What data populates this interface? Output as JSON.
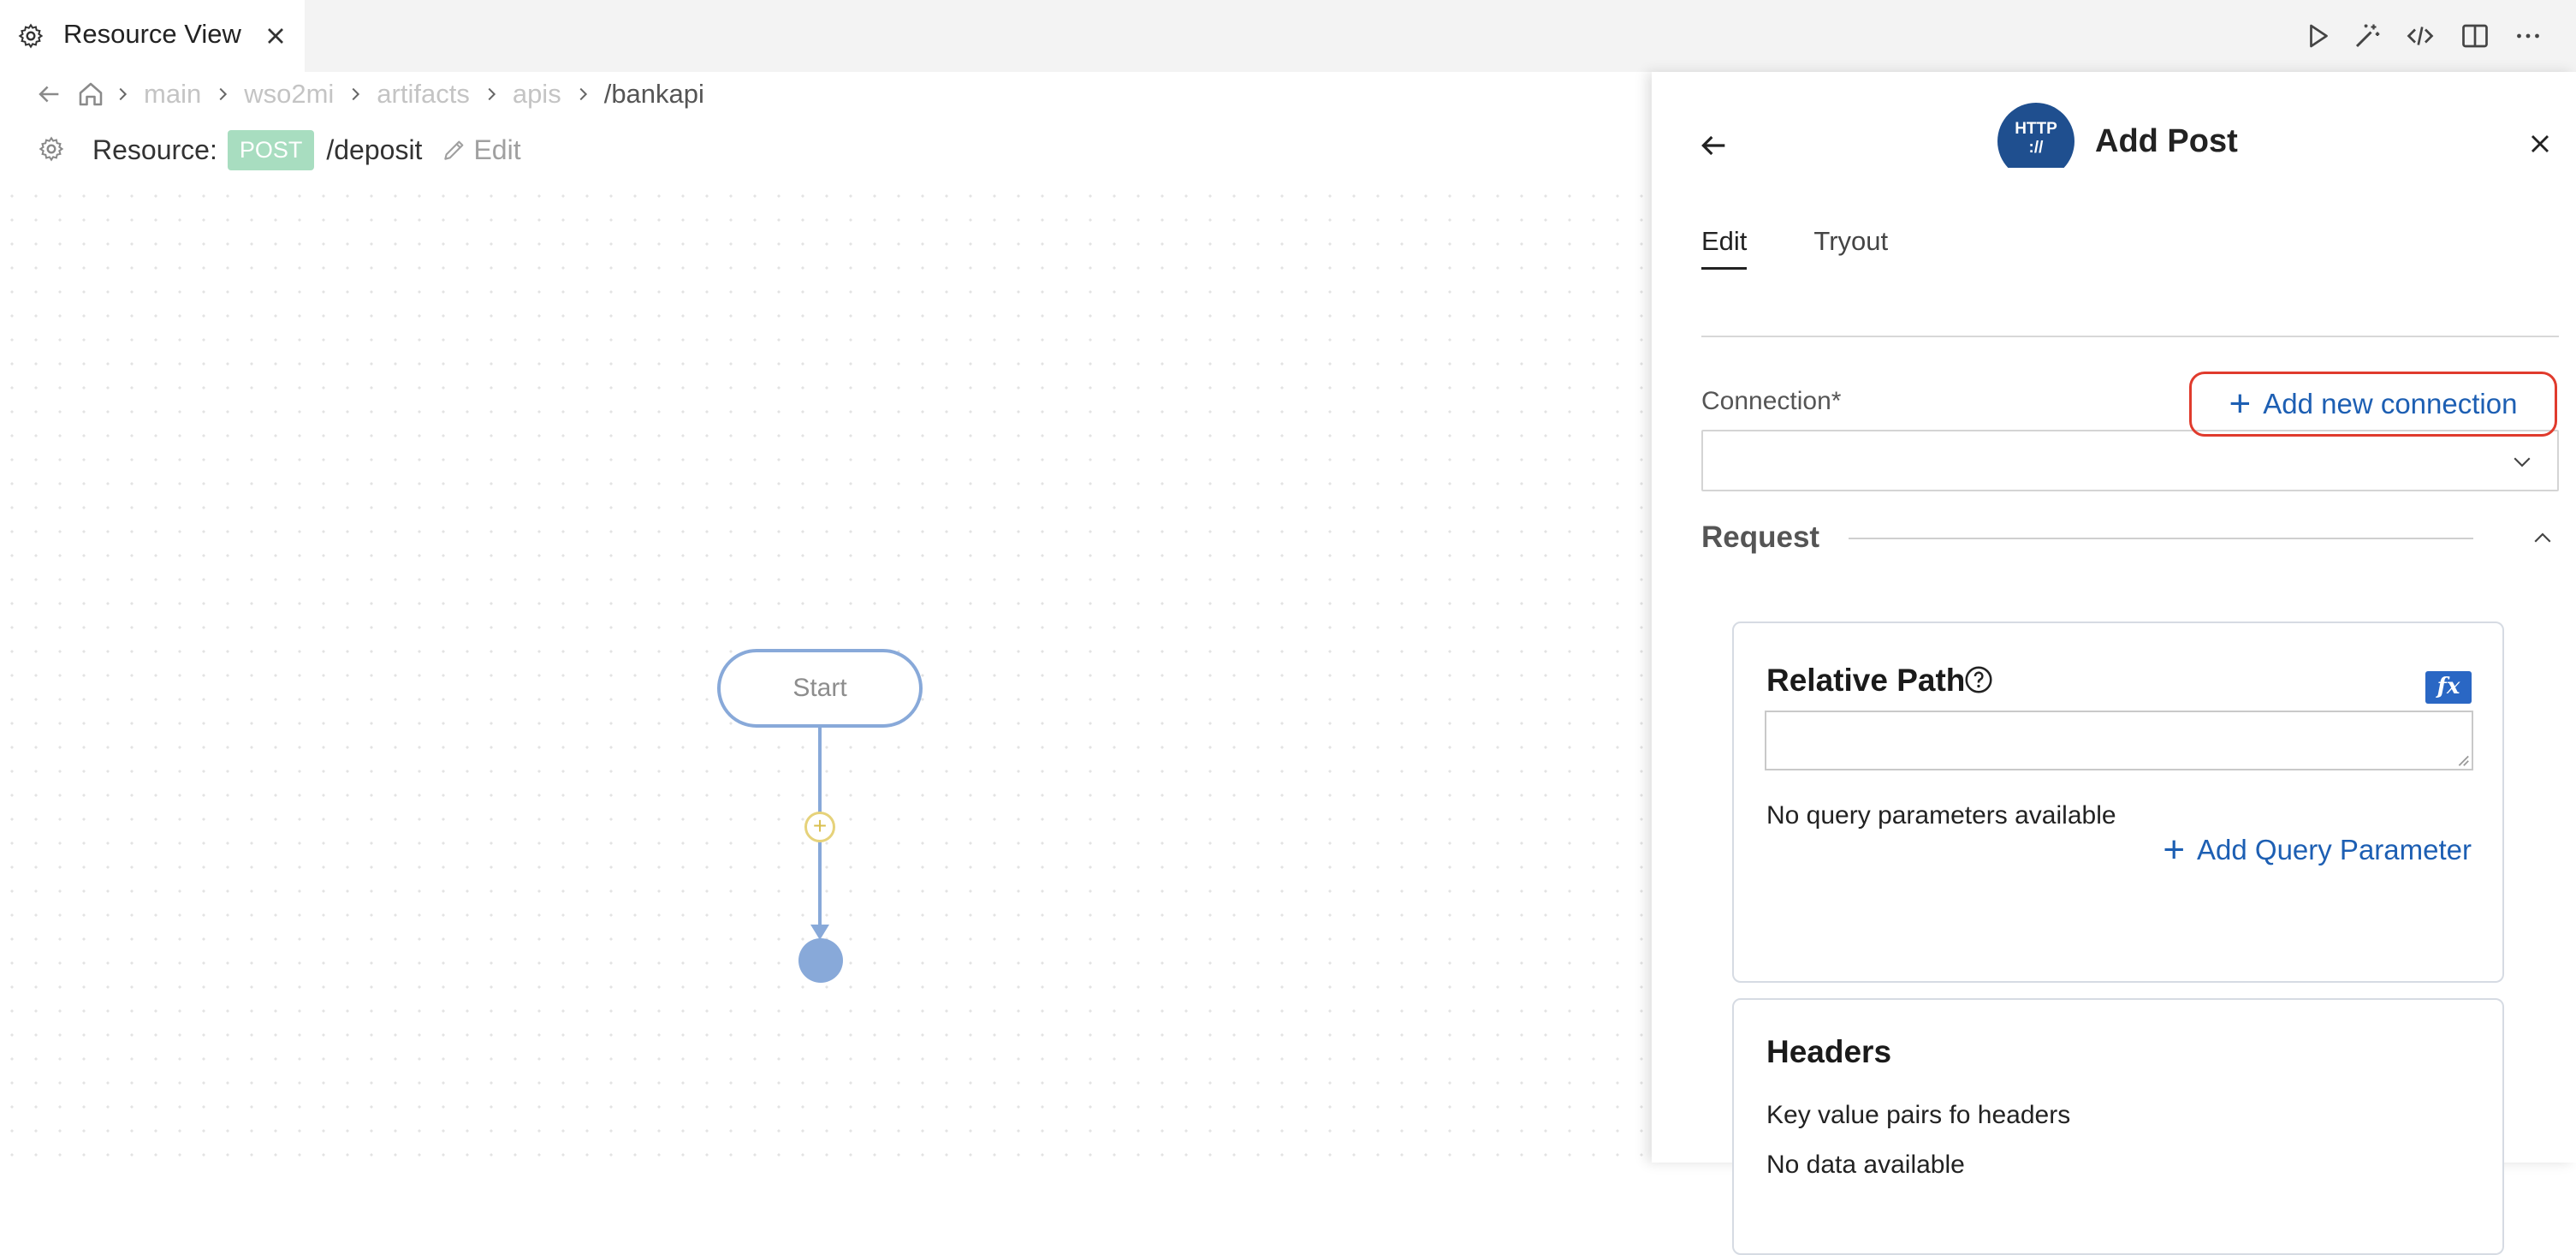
{
  "tab": {
    "title": "Resource View",
    "icon": "gear-icon"
  },
  "toolbar": {
    "icons": [
      "play-icon",
      "magic-wand-icon",
      "code-icon",
      "split-editor-icon",
      "more-icon"
    ]
  },
  "breadcrumb": {
    "items": [
      "main",
      "wso2mi",
      "artifacts",
      "apis"
    ],
    "current": "/bankapi"
  },
  "resource": {
    "label": "Resource:",
    "method": "POST",
    "path": "/deposit",
    "edit_label": "Edit",
    "method_color": "#a8ddc0"
  },
  "canvas": {
    "start_label": "Start",
    "add_symbol": "+"
  },
  "panel": {
    "title": "Add Post",
    "logo_text": "HTTP",
    "logo_subtext": "://",
    "tabs": [
      "Edit",
      "Tryout"
    ],
    "active_tab": "Edit",
    "connection_label": "Connection*",
    "add_connection_label": "Add new connection",
    "connection_value": "",
    "request_title": "Request",
    "relative_path": {
      "title": "Relative Path",
      "fx_label": "fx",
      "value": "",
      "no_query_text": "No query parameters available",
      "add_query_label": "Add Query Parameter"
    },
    "headers": {
      "title": "Headers",
      "description": "Key value pairs fo headers",
      "empty_text": "No data available"
    }
  },
  "colors": {
    "accent_blue": "#1d5fb3",
    "highlight_red": "#e03b2d",
    "flow_blue": "#88a9d9"
  }
}
